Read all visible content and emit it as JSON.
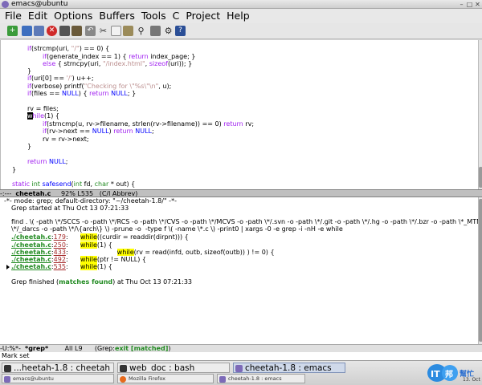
{
  "window": {
    "title": "emacs@ubuntu"
  },
  "menu": [
    "File",
    "Edit",
    "Options",
    "Buffers",
    "Tools",
    "C",
    "Project",
    "Help"
  ],
  "toolbar": [
    "new-file",
    "open-file",
    "open-directory",
    "kill-buffer",
    "save",
    "save-as",
    "undo",
    "cut",
    "copy",
    "paste",
    "search",
    "print",
    "preferences",
    "help"
  ],
  "code": {
    "l1": {
      "a": "if",
      "b": "(strcmp(uri, ",
      "c": "\"/\"",
      "d": ") == 0) {"
    },
    "l2": {
      "a": "if",
      "b": "(generate_index == 1) { ",
      "c": "return",
      "d": " index_page; }"
    },
    "l3": {
      "a": "else",
      "b": " { strncpy(uri, ",
      "c": "\"/index.html\"",
      "d": ", ",
      "e": "sizeof",
      "f": "(uri)); }"
    },
    "l4": "}",
    "l5": {
      "a": "if",
      "b": "(uri[0] == ",
      "c": "'/'",
      "d": ") u++;"
    },
    "l6": {
      "a": "if",
      "b": "(verbose) printf(",
      "c": "\"Checking for \\\"%s\\\"\\n\"",
      "d": ", u);"
    },
    "l7": {
      "a": "if",
      "b": "(files == ",
      "c": "NULL",
      "d": ") { ",
      "e": "return",
      "f": " ",
      "g": "NULL",
      "h": "; }"
    },
    "l8": "rv = files;",
    "l9": {
      "cur": "w",
      "a": "hile",
      "b": "(1) {"
    },
    "l10": {
      "a": "if",
      "b": "(strncmp(u, rv->filename, strlen(rv->filename)) == 0) ",
      "c": "return",
      "d": " rv;"
    },
    "l11": {
      "a": "if",
      "b": "(rv->next == ",
      "c": "NULL",
      "d": ") ",
      "e": "return",
      "f": " ",
      "g": "NULL",
      "h": ";"
    },
    "l12": "rv = rv->next;",
    "l13": "}",
    "l14": {
      "a": "return",
      "b": " ",
      "c": "NULL",
      "d": ";"
    },
    "l15": "}",
    "l16": {
      "a": "static",
      "b": " ",
      "c": "int",
      "d": " ",
      "e": "safesend",
      "f": "(",
      "g": "int",
      "h": " fd, ",
      "i": "char",
      "j": " * out) {"
    }
  },
  "modeline_top": {
    "flags": "-:---  ",
    "buffer": "cheetah.c",
    "rest": "     92% L535   (C/l Abbrev)"
  },
  "grep": {
    "mode": "-*- mode: grep; default-directory: \"~/cheetah-1.8/\" -*-",
    "started": "Grep started at Thu Oct 13 07:21:33",
    "find1": "find . \\( -path \\*/SCCS -o -path \\*/RCS -o -path \\*/CVS -o -path \\*/MCVS -o -path \\*/.svn -o -path \\*/.git -o -path \\*/.hg -o -path \\*/.bzr -o -path \\*_MTN -o -path",
    "find2": "\\*/_darcs -o -path \\*/\\{arch\\} \\) -prune -o  -type f \\( -name \\*.c \\) -print0 | xargs -0 -e grep -i -nH -e while",
    "results": [
      {
        "file": "./cheetah.c",
        "line": "179",
        "pre": "      ",
        "match": "while",
        "post": "((curdir = readdir(dirpnt))) {"
      },
      {
        "file": "./cheetah.c",
        "line": "250",
        "pre": "      ",
        "match": "while",
        "post": "(1) {"
      },
      {
        "file": "./cheetah.c",
        "line": "433",
        "pre": "                        ",
        "match": "while",
        "post": "(rv = read(infd, outb, sizeof(outb)) ) != 0) {"
      },
      {
        "file": "./cheetah.c",
        "line": "492",
        "pre": "      ",
        "match": "while",
        "post": "(ptr != NULL) {"
      },
      {
        "file": "./cheetah.c",
        "line": "535",
        "pre": "      ",
        "match": "while",
        "post": "(1) {"
      }
    ],
    "finished_a": "Grep finished (",
    "finished_b": "matches found",
    "finished_c": ") at Thu Oct 13 07:21:33"
  },
  "modeline_bottom": {
    "flags": "-U:%*-  ",
    "buffer": "*grep*",
    "rest_a": "        All L9      (Grep:",
    "status": "exit [matched]",
    "rest_b": ")"
  },
  "echo": "Mark set",
  "taskbar": {
    "row1": [
      "...heetah-1.8 : cheetah",
      "web_doc : bash",
      "cheetah-1.8 : emacs"
    ],
    "row2": [
      "emacs@ubuntu",
      "Mozilla Firefox",
      "cheetah-1.8 : emacs"
    ]
  },
  "tray": {
    "logo_line1": "IT",
    "logo_line2": "邦",
    "logo_line3": "幫忙",
    "clock": "13. Oct"
  }
}
